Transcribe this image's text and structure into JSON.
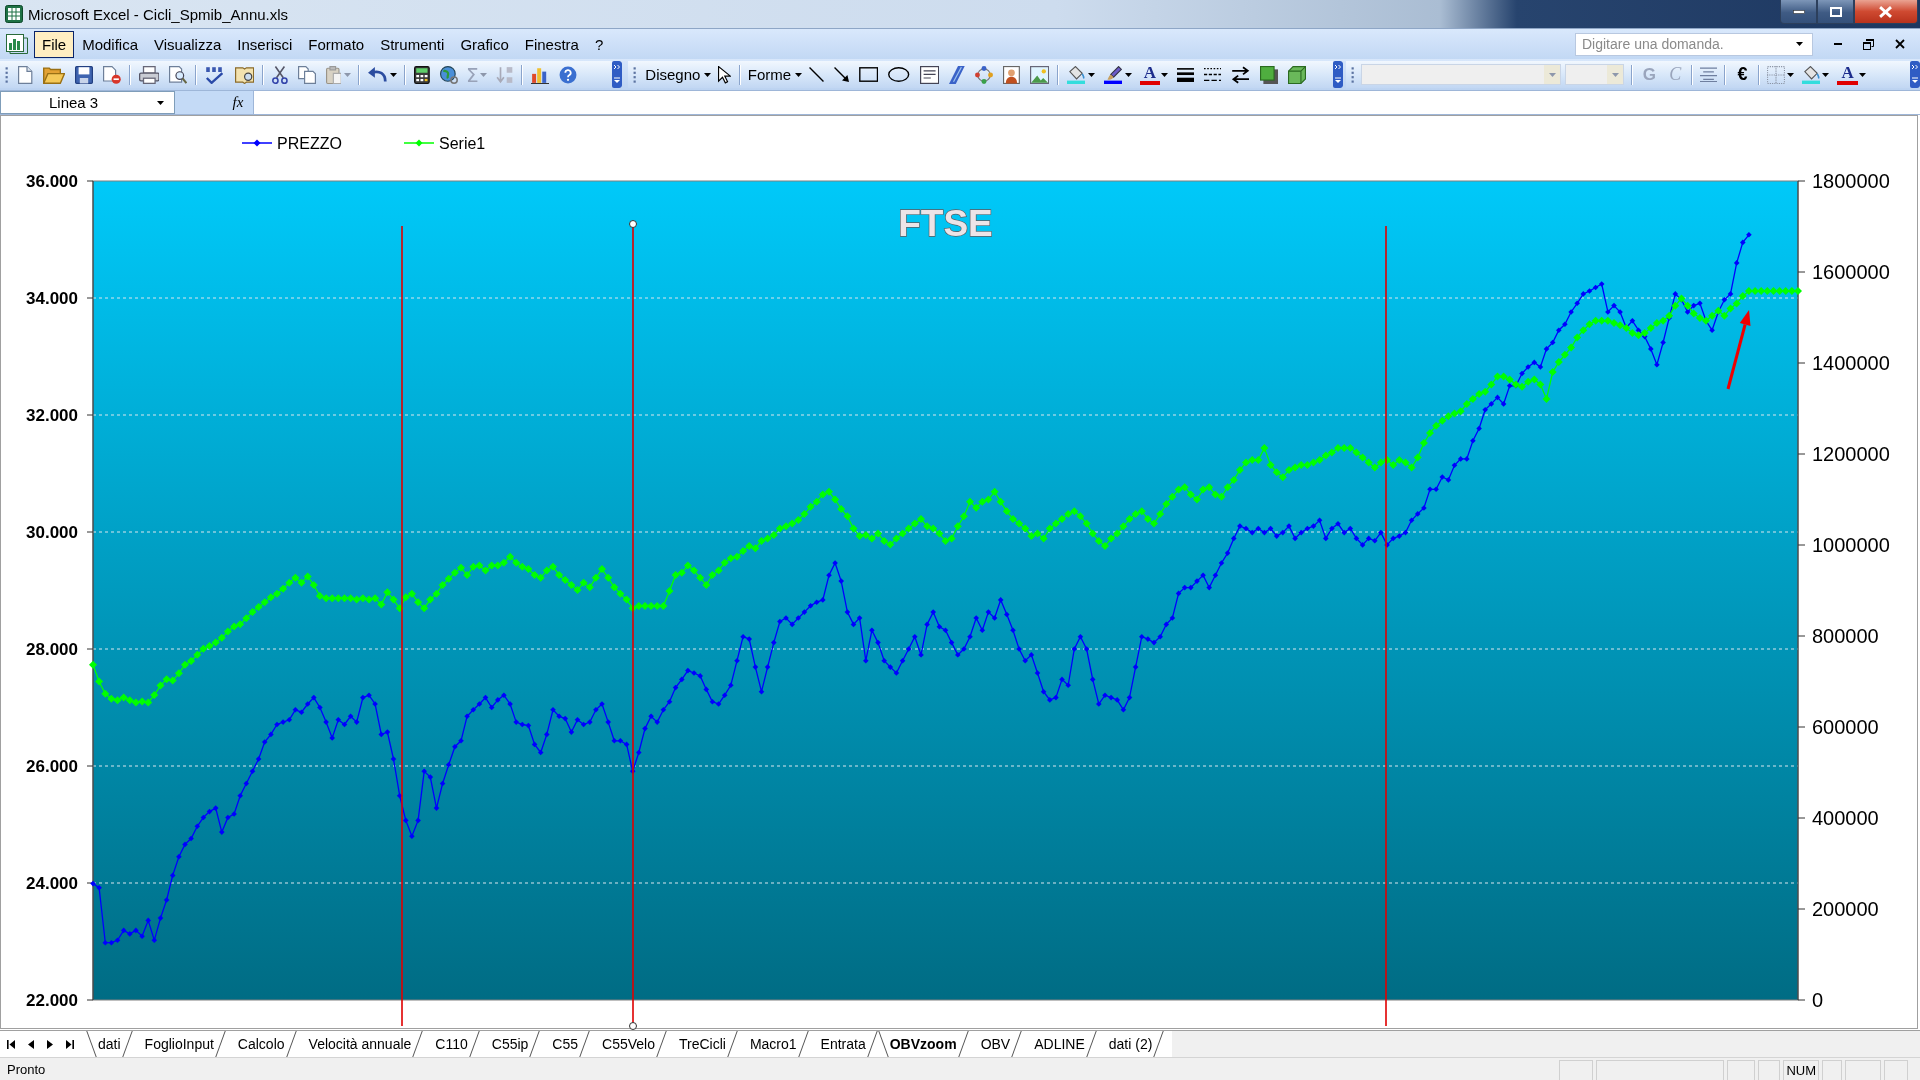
{
  "window": {
    "title": "Microsoft Excel - Cicli_Spmib_Annu.xls"
  },
  "menu_bar": {
    "items": [
      {
        "label": "File",
        "selected": true
      },
      {
        "label": "Modifica",
        "selected": false
      },
      {
        "label": "Visualizza",
        "selected": false
      },
      {
        "label": "Inserisci",
        "selected": false
      },
      {
        "label": "Formato",
        "selected": false
      },
      {
        "label": "Strumenti",
        "selected": false
      },
      {
        "label": "Grafico",
        "selected": false
      },
      {
        "label": "Finestra",
        "selected": false
      },
      {
        "label": "?",
        "selected": false
      }
    ],
    "help_box": {
      "placeholder": "Digitare una domanda."
    }
  },
  "toolbar": {
    "autosum": {
      "label": "Σ",
      "disabled": true
    },
    "drawing_menus": [
      "Disegno",
      "Forme"
    ],
    "font_color_letters": [
      "A",
      "A"
    ],
    "font_fields": [
      {
        "kind": "name",
        "disabled": true
      },
      {
        "kind": "size",
        "disabled": true
      }
    ],
    "format_buttons": [
      {
        "label": "G",
        "kind": "bold",
        "disabled": true
      },
      {
        "label": "C",
        "kind": "italic",
        "disabled": true
      },
      {
        "label": "€",
        "kind": "plain",
        "disabled": false
      }
    ]
  },
  "formula_bar": {
    "name_box": "Linea 3",
    "function_button": "fx"
  },
  "chart_sheet": {
    "chart_data": {
      "type": "line",
      "title": "FTSE",
      "legend": "top",
      "grid": true,
      "ylim": [
        22000,
        36000
      ],
      "yticks": [
        {
          "value": 22000,
          "label": "22.000"
        },
        {
          "value": 24000,
          "label": "24.000"
        },
        {
          "value": 26000,
          "label": "26.000"
        },
        {
          "value": 28000,
          "label": "28.000"
        },
        {
          "value": 30000,
          "label": "30.000"
        },
        {
          "value": 32000,
          "label": "32.000"
        },
        {
          "value": 34000,
          "label": "34.000"
        },
        {
          "value": 36000,
          "label": "36.000"
        }
      ],
      "y2lim": [
        0,
        1800000
      ],
      "y2ticks": [
        0,
        200000,
        400000,
        600000,
        800000,
        1000000,
        1200000,
        1400000,
        1600000,
        1800000
      ],
      "series": [
        {
          "name": "PREZZO",
          "color": "#0000ff",
          "marker": "diamond",
          "values": [
            23990,
            23920,
            22980,
            22980,
            23020,
            23190,
            23130,
            23190,
            23090,
            23360,
            23020,
            23400,
            23710,
            24130,
            24450,
            24660,
            24760,
            24970,
            25120,
            25220,
            25280,
            24870,
            25120,
            25180,
            25490,
            25700,
            25910,
            26120,
            26410,
            26540,
            26710,
            26750,
            26790,
            26960,
            26920,
            27060,
            27170,
            27000,
            26750,
            26480,
            26790,
            26710,
            26850,
            26750,
            27170,
            27210,
            27060,
            26540,
            26580,
            26120,
            25490,
            25070,
            24800,
            25070,
            25910,
            25810,
            25280,
            25700,
            26020,
            26330,
            26430,
            26850,
            26960,
            27060,
            27170,
            27000,
            27130,
            27210,
            27060,
            26750,
            26710,
            26690,
            26370,
            26230,
            26540,
            26960,
            26850,
            26810,
            26580,
            26790,
            26710,
            26750,
            26960,
            27060,
            26750,
            26430,
            26430,
            26370,
            25910,
            26230,
            26640,
            26850,
            26750,
            26960,
            27100,
            27340,
            27480,
            27630,
            27590,
            27540,
            27310,
            27100,
            27060,
            27210,
            27380,
            27800,
            28210,
            28170,
            27690,
            27270,
            27690,
            28110,
            28470,
            28530,
            28420,
            28530,
            28630,
            28740,
            28800,
            28840,
            29260,
            29470,
            29160,
            28630,
            28420,
            28530,
            27800,
            28320,
            28110,
            27800,
            27690,
            27590,
            27800,
            28000,
            28210,
            27900,
            28420,
            28630,
            28380,
            28320,
            28110,
            27900,
            28000,
            28210,
            28530,
            28320,
            28630,
            28530,
            28840,
            28590,
            28320,
            28000,
            27800,
            27900,
            27590,
            27270,
            27130,
            27170,
            27480,
            27380,
            28000,
            28210,
            28000,
            27480,
            27060,
            27210,
            27170,
            27130,
            26960,
            27170,
            27690,
            28210,
            28170,
            28110,
            28210,
            28420,
            28530,
            28950,
            29050,
            29050,
            29160,
            29260,
            29050,
            29260,
            29470,
            29640,
            29890,
            30100,
            30060,
            29990,
            30060,
            29990,
            30060,
            29930,
            29990,
            30100,
            29890,
            29990,
            30060,
            30100,
            30200,
            29890,
            30060,
            30140,
            29990,
            30060,
            29890,
            29780,
            29890,
            29850,
            29990,
            29780,
            29890,
            29930,
            29990,
            30200,
            30310,
            30410,
            30730,
            30730,
            30940,
            30890,
            31140,
            31250,
            31250,
            31560,
            31770,
            32090,
            32190,
            32300,
            32190,
            32500,
            32500,
            32710,
            32820,
            32900,
            32820,
            33130,
            33240,
            33450,
            33550,
            33760,
            33910,
            34070,
            34120,
            34180,
            34240,
            33760,
            33870,
            33760,
            33490,
            33610,
            33450,
            33340,
            33130,
            32860,
            33240,
            33660,
            34070,
            33970,
            33760,
            33870,
            33910,
            33610,
            33450,
            33760,
            33970,
            34070,
            34600,
            34950,
            35080
          ]
        },
        {
          "name": "Serie1",
          "color": "#00ff00",
          "axis": "y2",
          "marker": "diamond",
          "values": [
            737000,
            700000,
            673000,
            662000,
            659000,
            665000,
            659000,
            654000,
            656000,
            654000,
            670000,
            691000,
            705000,
            702000,
            718000,
            737000,
            745000,
            759000,
            772000,
            778000,
            786000,
            796000,
            810000,
            821000,
            826000,
            839000,
            853000,
            864000,
            874000,
            885000,
            893000,
            904000,
            917000,
            928000,
            917000,
            931000,
            912000,
            888000,
            883000,
            883000,
            883000,
            883000,
            883000,
            880000,
            883000,
            880000,
            883000,
            869000,
            896000,
            880000,
            861000,
            885000,
            893000,
            874000,
            861000,
            880000,
            893000,
            912000,
            926000,
            939000,
            950000,
            934000,
            952000,
            955000,
            944000,
            955000,
            955000,
            961000,
            974000,
            961000,
            952000,
            947000,
            934000,
            928000,
            944000,
            952000,
            934000,
            923000,
            912000,
            901000,
            917000,
            907000,
            928000,
            947000,
            928000,
            907000,
            893000,
            880000,
            861000,
            866000,
            866000,
            866000,
            866000,
            866000,
            899000,
            934000,
            939000,
            955000,
            944000,
            928000,
            912000,
            934000,
            944000,
            961000,
            971000,
            974000,
            987000,
            998000,
            993000,
            1009000,
            1014000,
            1022000,
            1036000,
            1041000,
            1047000,
            1055000,
            1068000,
            1084000,
            1095000,
            1111000,
            1117000,
            1100000,
            1079000,
            1063000,
            1036000,
            1020000,
            1022000,
            1014000,
            1025000,
            1009000,
            1001000,
            1014000,
            1025000,
            1036000,
            1047000,
            1057000,
            1041000,
            1036000,
            1025000,
            1009000,
            1014000,
            1041000,
            1063000,
            1095000,
            1082000,
            1095000,
            1100000,
            1117000,
            1095000,
            1074000,
            1057000,
            1047000,
            1036000,
            1020000,
            1025000,
            1014000,
            1036000,
            1047000,
            1057000,
            1068000,
            1074000,
            1063000,
            1047000,
            1025000,
            1009000,
            998000,
            1014000,
            1025000,
            1041000,
            1057000,
            1068000,
            1074000,
            1057000,
            1047000,
            1068000,
            1090000,
            1106000,
            1122000,
            1127000,
            1111000,
            1100000,
            1122000,
            1127000,
            1111000,
            1106000,
            1127000,
            1143000,
            1165000,
            1181000,
            1187000,
            1187000,
            1213000,
            1176000,
            1160000,
            1149000,
            1165000,
            1170000,
            1176000,
            1176000,
            1181000,
            1187000,
            1197000,
            1203000,
            1213000,
            1213000,
            1213000,
            1203000,
            1192000,
            1181000,
            1170000,
            1181000,
            1187000,
            1176000,
            1187000,
            1181000,
            1170000,
            1192000,
            1224000,
            1246000,
            1262000,
            1273000,
            1283000,
            1289000,
            1294000,
            1310000,
            1321000,
            1332000,
            1337000,
            1353000,
            1370000,
            1370000,
            1364000,
            1353000,
            1348000,
            1359000,
            1364000,
            1353000,
            1321000,
            1380000,
            1402000,
            1418000,
            1434000,
            1456000,
            1472000,
            1485000,
            1493000,
            1493000,
            1493000,
            1488000,
            1483000,
            1477000,
            1466000,
            1461000,
            1466000,
            1477000,
            1488000,
            1493000,
            1504000,
            1526000,
            1542000,
            1526000,
            1509000,
            1499000,
            1493000,
            1504000,
            1515000,
            1504000,
            1520000,
            1531000,
            1547000,
            1558000,
            1558000,
            1558000,
            1558000,
            1558000,
            1558000,
            1558000,
            1558000,
            1558000
          ]
        }
      ]
    },
    "shapes": [
      {
        "kind": "line",
        "selected": false
      },
      {
        "kind": "line",
        "selected": true
      },
      {
        "kind": "line",
        "selected": false
      },
      {
        "kind": "arrow",
        "selected": false
      }
    ]
  },
  "sheet_tabs": [
    {
      "label": "dati",
      "selected": false
    },
    {
      "label": "FoglioInput",
      "selected": false
    },
    {
      "label": "Calcolo",
      "selected": false
    },
    {
      "label": "Velocità annuale",
      "selected": false
    },
    {
      "label": "C110",
      "selected": false
    },
    {
      "label": "C55ip",
      "selected": false
    },
    {
      "label": "C55",
      "selected": false
    },
    {
      "label": "C55Velo",
      "selected": false
    },
    {
      "label": "TreCicli",
      "selected": false
    },
    {
      "label": "Macro1",
      "selected": false
    },
    {
      "label": "Entrata",
      "selected": false
    },
    {
      "label": "OBVzoom",
      "selected": true
    },
    {
      "label": "OBV",
      "selected": false
    },
    {
      "label": "ADLINE",
      "selected": false
    },
    {
      "label": "dati (2)",
      "selected": false
    }
  ],
  "status_bar": {
    "text": "Pronto",
    "indicators": [
      "NUM"
    ]
  }
}
